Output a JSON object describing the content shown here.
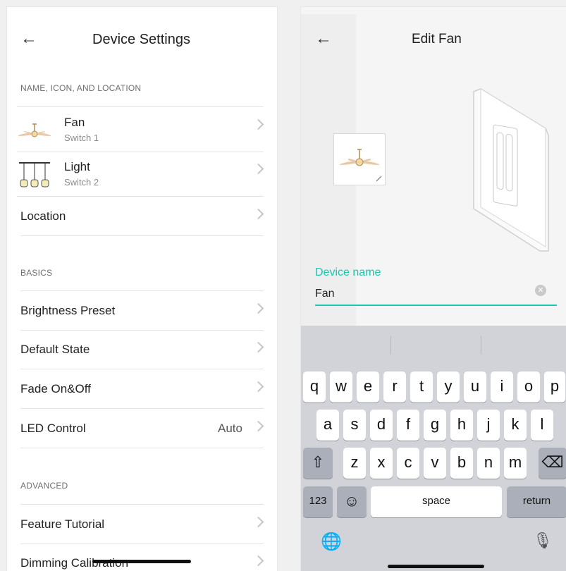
{
  "left": {
    "title": "Device Settings",
    "back_glyph": "←",
    "sections": {
      "name_icon_location": "NAME, ICON, AND LOCATION",
      "basics": "BASICS",
      "advanced": "ADVANCED"
    },
    "devices": [
      {
        "name": "Fan",
        "sub": "Switch 1",
        "icon": "ceiling-fan-icon"
      },
      {
        "name": "Light",
        "sub": "Switch 2",
        "icon": "pendant-lights-icon"
      }
    ],
    "location_label": "Location",
    "basics_items": [
      {
        "label": "Brightness Preset",
        "value": ""
      },
      {
        "label": "Default State",
        "value": ""
      },
      {
        "label": "Fade On&Off",
        "value": ""
      },
      {
        "label": "LED Control",
        "value": "Auto"
      }
    ],
    "advanced_items": [
      {
        "label": "Feature Tutorial"
      },
      {
        "label": "Dimming Calibration"
      }
    ]
  },
  "right": {
    "title": "Edit Fan",
    "back_glyph": "←",
    "field_label": "Device name",
    "field_value": "Fan",
    "keyboard": {
      "row1": [
        "q",
        "w",
        "e",
        "r",
        "t",
        "y",
        "u",
        "i",
        "o",
        "p"
      ],
      "row2": [
        "a",
        "s",
        "d",
        "f",
        "g",
        "h",
        "j",
        "k",
        "l"
      ],
      "row3": [
        "z",
        "x",
        "c",
        "v",
        "b",
        "n",
        "m"
      ],
      "num_key": "123",
      "space_key": "space",
      "return_key": "return",
      "shift_glyph": "⇧",
      "delete_glyph": "⌫",
      "emoji_glyph": "☺",
      "globe_glyph": "🌐",
      "mic_glyph": "🎙"
    }
  },
  "colors": {
    "accent": "#1cc5b0",
    "keyboard_bg": "#d1d3d9",
    "special_key": "#abafb9"
  }
}
